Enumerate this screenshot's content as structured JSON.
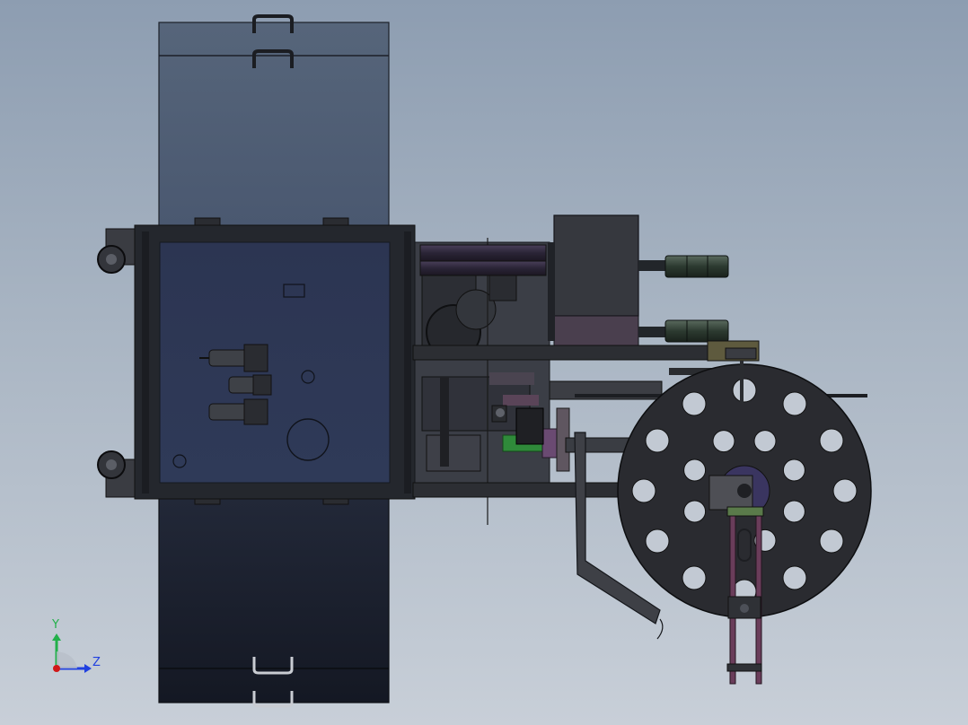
{
  "view": {
    "background_top": "#8d9db1",
    "background_bottom": "#c8cfd8"
  },
  "triad": {
    "y_label": "Y",
    "z_label": "Z",
    "y_color": "#22b04a",
    "z_color": "#2040e0",
    "origin_color": "#d01818"
  },
  "colors": {
    "frame": "#2b2d33",
    "upper_panel": "#4f5d72",
    "main_panel": "#2f3a55",
    "lower_panel": "#1a1f2b",
    "wheel": "#2d2f36",
    "accent_purple": "#6a4a5e",
    "accent_green": "#2f8a3a",
    "accent_tan": "#b09a60"
  }
}
